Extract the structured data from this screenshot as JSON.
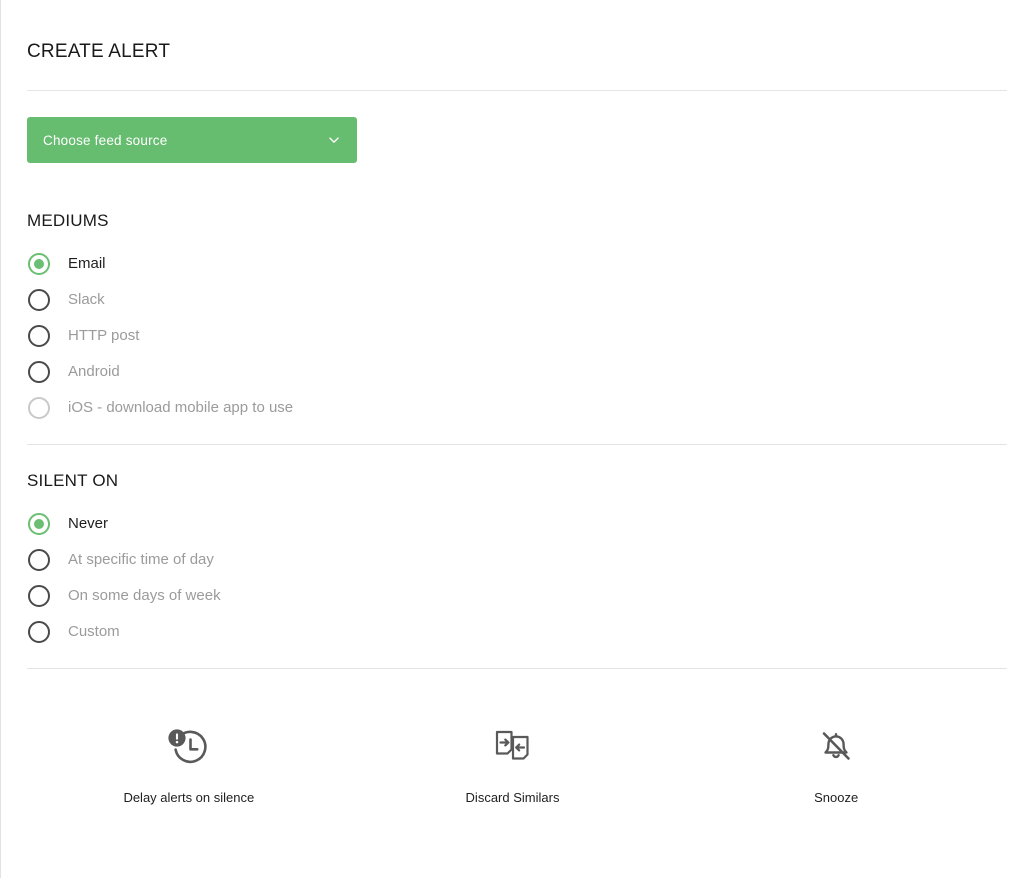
{
  "page": {
    "title": "CREATE ALERT"
  },
  "feed_source": {
    "label": "Choose feed source",
    "chevron_icon": "chevron-down-icon",
    "background_color": "#66bc6f",
    "text_color": "#ffffff"
  },
  "mediums": {
    "title": "MEDIUMS",
    "options": [
      {
        "label": "Email",
        "selected": true,
        "dimmed": false,
        "disabled": false
      },
      {
        "label": "Slack",
        "selected": false,
        "dimmed": true,
        "disabled": false
      },
      {
        "label": "HTTP post",
        "selected": false,
        "dimmed": true,
        "disabled": false
      },
      {
        "label": "Android",
        "selected": false,
        "dimmed": true,
        "disabled": false
      },
      {
        "label": "iOS - download mobile app to use",
        "selected": false,
        "dimmed": true,
        "disabled": true
      }
    ]
  },
  "silent_on": {
    "title": "SILENT ON",
    "options": [
      {
        "label": "Never",
        "selected": true,
        "dimmed": false,
        "disabled": false
      },
      {
        "label": "At specific time of day",
        "selected": false,
        "dimmed": true,
        "disabled": false
      },
      {
        "label": "On some days of week",
        "selected": false,
        "dimmed": true,
        "disabled": false
      },
      {
        "label": "Custom",
        "selected": false,
        "dimmed": true,
        "disabled": false
      }
    ]
  },
  "actions": [
    {
      "label": "Delay alerts on silence",
      "icon": "clock-alert-icon"
    },
    {
      "label": "Discard Similars",
      "icon": "discard-similars-icon"
    },
    {
      "label": "Snooze",
      "icon": "bell-off-icon"
    }
  ],
  "colors": {
    "accent_green": "#66bc6f",
    "selected_radio": "#6abf73",
    "radio_outline": "#4a4a4a",
    "radio_outline_disabled": "#c9c9c9",
    "text_primary": "#1f1f1f",
    "text_muted": "#9b9b9b",
    "divider": "#e4e4e4",
    "icon_gray": "#595959"
  }
}
